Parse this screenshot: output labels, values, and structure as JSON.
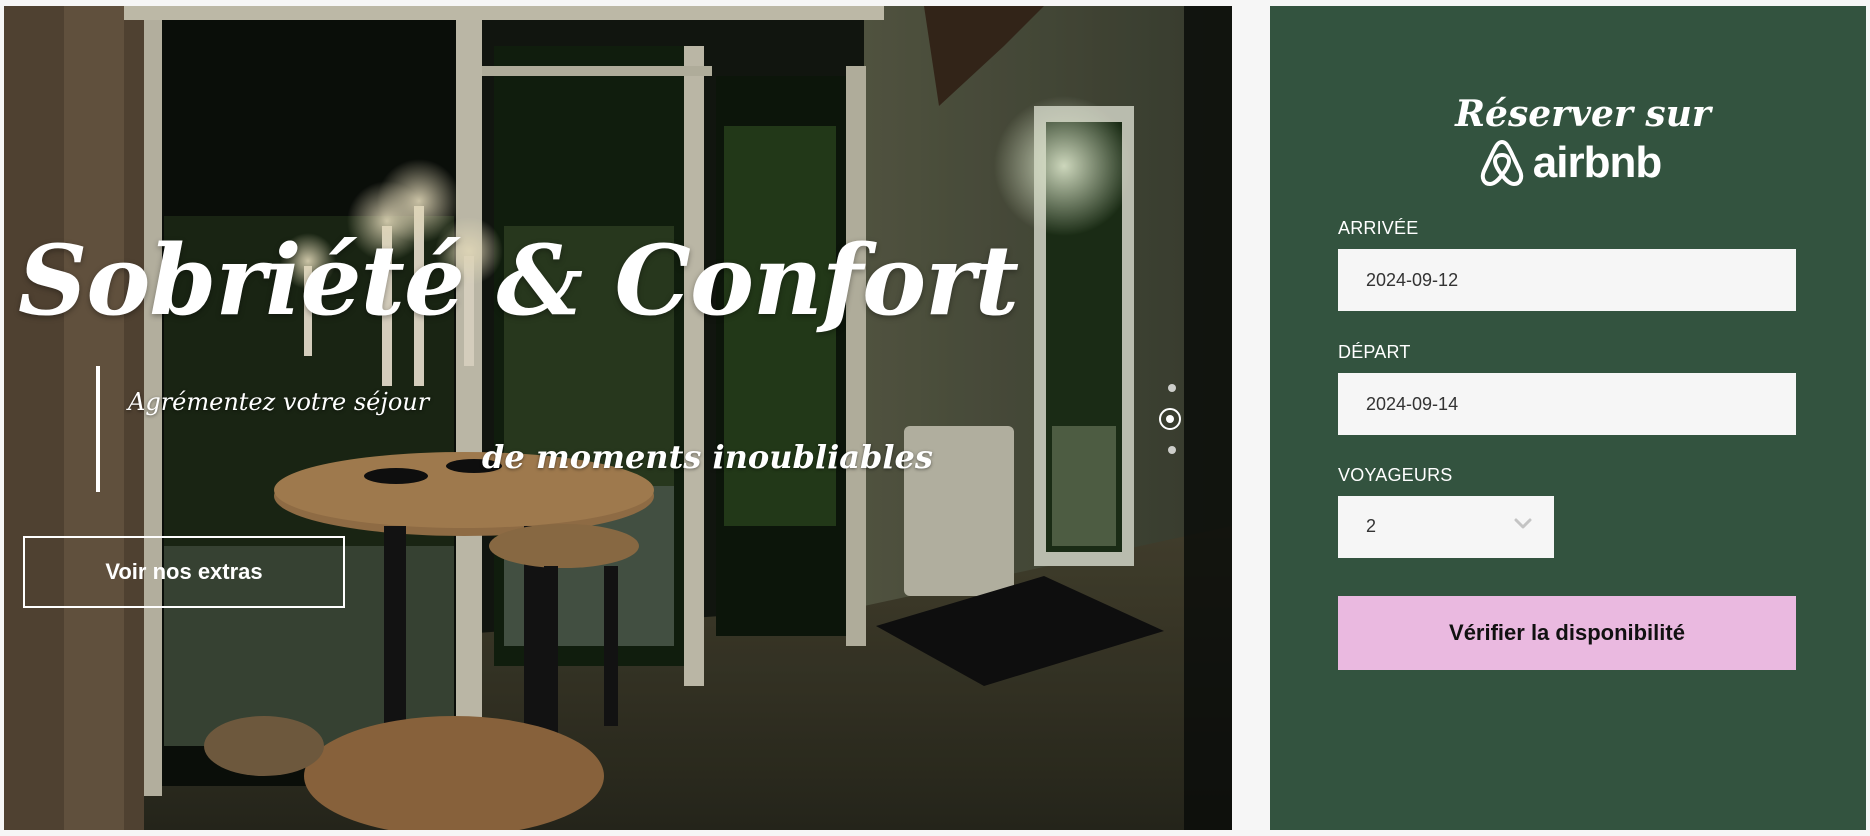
{
  "hero": {
    "title": "Sobriété & Confort",
    "subtitle_line1": "Agrémentez votre séjour",
    "subtitle_line2": "de moments inoubliables",
    "cta_label": "Voir nos extras",
    "slider": {
      "slide_count": 3,
      "active_slide": 2
    }
  },
  "booking": {
    "heading": "Réserver sur",
    "brand_name": "airbnb",
    "arrival": {
      "label": "ARRIVÉE",
      "value": "2024-09-12"
    },
    "departure": {
      "label": "DÉPART",
      "value": "2024-09-14"
    },
    "guests": {
      "label": "VOYAGEURS",
      "value": "2"
    },
    "submit_label": "Vérifier la disponibilité"
  },
  "colors": {
    "panel_background": "#33533f",
    "submit_button": "#eab9e0",
    "input_background": "#f6f6f6",
    "text_light": "#ffffff"
  },
  "icons": {
    "brand_logo": "airbnb-belo-icon",
    "select_arrow": "chevron-down-icon"
  }
}
